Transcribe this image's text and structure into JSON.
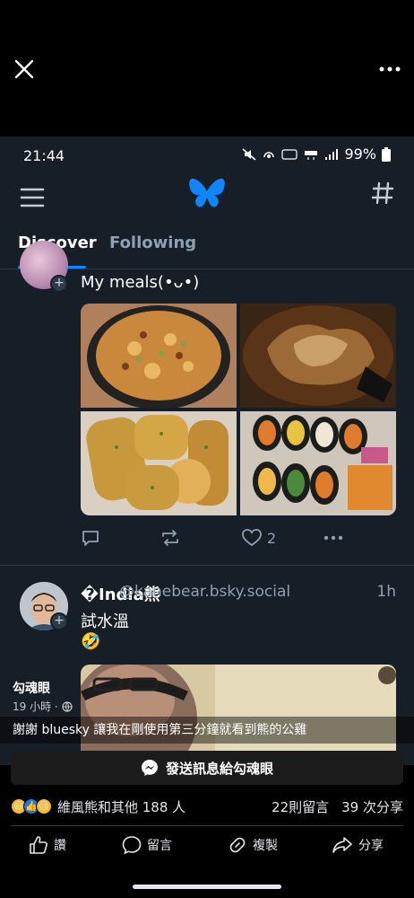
{
  "viewer": {
    "close_icon": "close-icon",
    "more_icon": "more-icon"
  },
  "status_bar": {
    "time": "21:44",
    "battery": "99%"
  },
  "bluesky": {
    "header": {
      "menu_icon": "menu-icon",
      "logo": "butterfly-logo",
      "feeds_icon": "hashtag-icon"
    },
    "tabs": [
      {
        "label": "Discover",
        "active": true
      },
      {
        "label": "Following",
        "active": false
      }
    ],
    "accent_color": "#1185fe",
    "post1": {
      "text": "My meals(•ᴗ•)",
      "likes": "2"
    },
    "post2": {
      "display_name": "�India熊",
      "handle": "@kanebear.bsky.social",
      "time": "1h",
      "text": "試水溫",
      "emoji": "🤣"
    }
  },
  "facebook": {
    "author": "勾魂眼",
    "post_time": "19 小時 ·",
    "caption": "謝謝 bluesky 讓我在剛使用第三分鐘就看到熊的公雞",
    "message_button": "發送訊息給勾魂眼",
    "reactions_text": "維風熊和其他 188 人",
    "comments": "22則留言",
    "shares": "39 次分享",
    "actions": {
      "like": "讚",
      "comment": "留言",
      "copy": "複製",
      "share": "分享"
    }
  }
}
